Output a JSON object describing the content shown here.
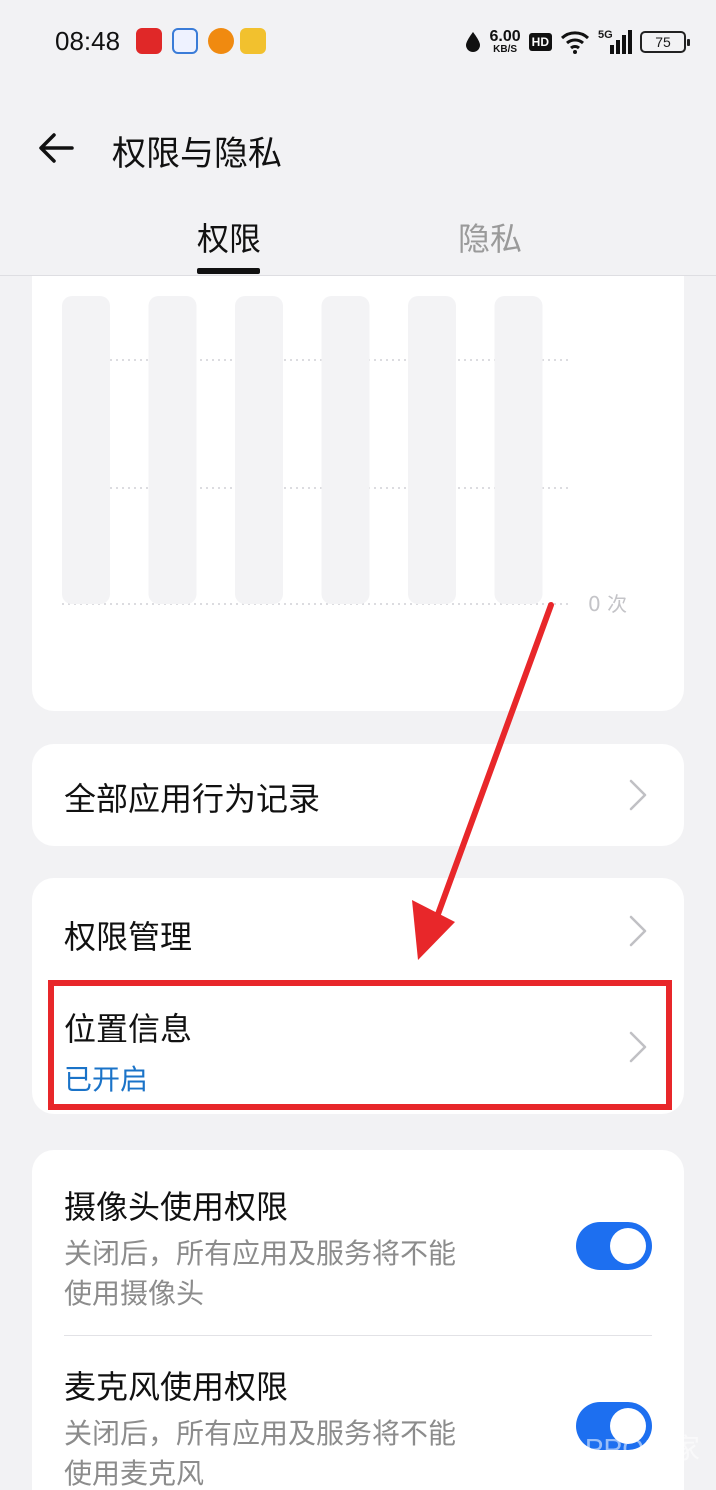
{
  "status_bar": {
    "time": "08:48",
    "speed_value": "6.00",
    "speed_unit": "KB/S",
    "hd_label": "HD",
    "network_label": "5G",
    "battery": "75",
    "notification_icons": [
      "app-icon-red",
      "app-icon-ball",
      "app-icon-orange",
      "app-icon-yellow"
    ]
  },
  "header": {
    "title": "权限与隐私",
    "tabs": [
      {
        "label": "权限",
        "active": true
      },
      {
        "label": "隐私",
        "active": false
      }
    ]
  },
  "chart_data": {
    "type": "bar",
    "categories": [
      "",
      "",
      "",
      "",
      "",
      ""
    ],
    "values": [
      0,
      0,
      0,
      0,
      0,
      0
    ],
    "baseline_label": "0 次"
  },
  "all_apps_record": {
    "label": "全部应用行为记录"
  },
  "permission_card": {
    "permission_management": "权限管理",
    "location": {
      "label": "位置信息",
      "status": "已开启"
    }
  },
  "camera": {
    "title": "摄像头使用权限",
    "desc_line1": "关闭后，所有应用及服务将不能",
    "desc_line2": "使用摄像头",
    "enabled": true
  },
  "microphone": {
    "title": "麦克风使用权限",
    "desc_line1": "关闭后，所有应用及服务将不能",
    "desc_line2": "使用麦克风",
    "enabled": true
  },
  "watermark": {
    "text": "OPPO之家",
    "url": "www.oppojia.com"
  },
  "colors": {
    "accent": "#1d6ff0",
    "link_status": "#1a73c8",
    "annotation": "#e8272a",
    "background": "#f2f2f4"
  }
}
